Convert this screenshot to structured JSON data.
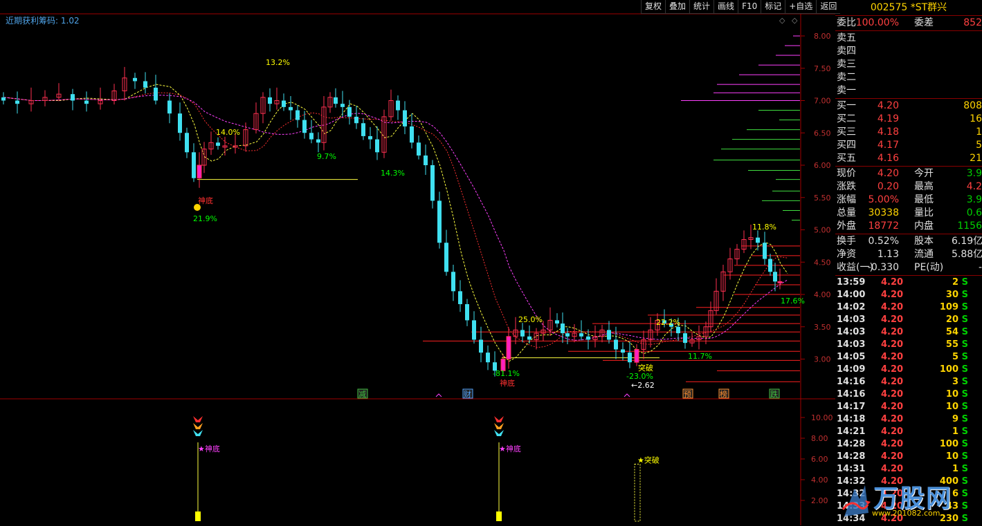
{
  "toolbar": {
    "items": [
      "复权",
      "叠加",
      "统计",
      "画线",
      "F10",
      "标记",
      "+自选",
      "返回"
    ]
  },
  "indicator": {
    "name": "近期获利筹码",
    "value": "1.02"
  },
  "stock": {
    "code": "002575",
    "name": "*ST群兴"
  },
  "quote": {
    "weibi_label": "委比",
    "weibi": "100.00%",
    "weicha_label": "委差",
    "weicha": "852",
    "sell": [
      {
        "label": "卖五",
        "price": "",
        "vol": ""
      },
      {
        "label": "卖四",
        "price": "",
        "vol": ""
      },
      {
        "label": "卖三",
        "price": "",
        "vol": ""
      },
      {
        "label": "卖二",
        "price": "",
        "vol": ""
      },
      {
        "label": "卖一",
        "price": "",
        "vol": ""
      }
    ],
    "buy": [
      {
        "label": "买一",
        "price": "4.20",
        "vol": "808"
      },
      {
        "label": "买二",
        "price": "4.19",
        "vol": "16"
      },
      {
        "label": "买三",
        "price": "4.18",
        "vol": "1"
      },
      {
        "label": "买四",
        "price": "4.17",
        "vol": "5"
      },
      {
        "label": "买五",
        "price": "4.16",
        "vol": "21"
      }
    ],
    "stats": [
      {
        "l": "现价",
        "v": "4.20",
        "vc": "red",
        "l2": "今开",
        "v2": "3.9",
        "v2c": "grn"
      },
      {
        "l": "涨跌",
        "v": "0.20",
        "vc": "red",
        "l2": "最高",
        "v2": "4.2",
        "v2c": "red"
      },
      {
        "l": "涨幅",
        "v": "5.00%",
        "vc": "red",
        "l2": "最低",
        "v2": "3.9",
        "v2c": "grn"
      },
      {
        "l": "总量",
        "v": "30338",
        "vc": "yel",
        "l2": "量比",
        "v2": "0.6",
        "v2c": "grn"
      },
      {
        "l": "外盘",
        "v": "18772",
        "vc": "red",
        "l2": "内盘",
        "v2": "1156",
        "v2c": "grn"
      }
    ],
    "fund": [
      {
        "l": "换手",
        "v": "0.52%",
        "l2": "股本",
        "v2": "6.19亿"
      },
      {
        "l": "净资",
        "v": "1.13",
        "l2": "流通",
        "v2": "5.88亿"
      },
      {
        "l": "收益(一)",
        "v": "-0.330",
        "l2": "PE(动)",
        "v2": "-"
      }
    ]
  },
  "ticks": [
    {
      "t": "13:59",
      "p": "4.20",
      "q": "2",
      "s": "S"
    },
    {
      "t": "14:00",
      "p": "4.20",
      "q": "30",
      "s": "S"
    },
    {
      "t": "14:02",
      "p": "4.20",
      "q": "109",
      "s": "S"
    },
    {
      "t": "14:03",
      "p": "4.20",
      "q": "20",
      "s": "S"
    },
    {
      "t": "14:03",
      "p": "4.20",
      "q": "54",
      "s": "S"
    },
    {
      "t": "14:03",
      "p": "4.20",
      "q": "55",
      "s": "S"
    },
    {
      "t": "14:05",
      "p": "4.20",
      "q": "5",
      "s": "S"
    },
    {
      "t": "14:09",
      "p": "4.20",
      "q": "100",
      "s": "S"
    },
    {
      "t": "14:16",
      "p": "4.20",
      "q": "3",
      "s": "S"
    },
    {
      "t": "14:16",
      "p": "4.20",
      "q": "10",
      "s": "S"
    },
    {
      "t": "14:17",
      "p": "4.20",
      "q": "10",
      "s": "S"
    },
    {
      "t": "14:18",
      "p": "4.20",
      "q": "9",
      "s": "S"
    },
    {
      "t": "14:21",
      "p": "4.20",
      "q": "1",
      "s": "S"
    },
    {
      "t": "14:28",
      "p": "4.20",
      "q": "100",
      "s": "S"
    },
    {
      "t": "14:28",
      "p": "4.20",
      "q": "10",
      "s": "S"
    },
    {
      "t": "14:31",
      "p": "4.20",
      "q": "1",
      "s": "S"
    },
    {
      "t": "14:32",
      "p": "4.20",
      "q": "400",
      "s": "S"
    },
    {
      "t": "14:32",
      "p": "4.20",
      "q": "6",
      "s": "S"
    },
    {
      "t": "14:33",
      "p": "4.20",
      "q": "43",
      "s": "S"
    },
    {
      "t": "14:34",
      "p": "4.20",
      "q": "230",
      "s": "S"
    }
  ],
  "watermark": {
    "brand": "万股网",
    "url": "www.201082.com"
  },
  "chart_data": [
    {
      "type": "candlestick",
      "price_axis": [
        "8.00",
        "7.50",
        "7.00",
        "6.50",
        "6.00",
        "5.50",
        "5.00",
        "4.50",
        "4.00",
        "3.50",
        "3.00"
      ],
      "ylim": [
        2.6,
        8.3
      ],
      "annotations": [
        {
          "text": "13.2%",
          "color": "#ffff00"
        },
        {
          "text": "14.0%",
          "color": "#ffff00"
        },
        {
          "text": "9.7%",
          "color": "#00ff00"
        },
        {
          "text": "14.3%",
          "color": "#00ff00"
        },
        {
          "text": "21.9%",
          "color": "#00ff00"
        },
        {
          "text": "神底",
          "color": "#ff3030"
        },
        {
          "text": "25.0%",
          "color": "#ffff00"
        },
        {
          "text": "-81.1%",
          "color": "#00ff00"
        },
        {
          "text": "神底",
          "color": "#ff3030"
        },
        {
          "text": "22.2%",
          "color": "#ffff00"
        },
        {
          "text": "突破",
          "color": "#ffff00"
        },
        {
          "text": "-23.0%",
          "color": "#00ff00"
        },
        {
          "text": "←2.62",
          "color": "#ffffff"
        },
        {
          "text": "11.7%",
          "color": "#00ff00"
        },
        {
          "text": "11.8%",
          "color": "#ffff00"
        },
        {
          "text": "17.6%",
          "color": "#00ff00"
        }
      ],
      "event_tags": [
        "减",
        "财",
        "预",
        "榜",
        "跌"
      ]
    },
    {
      "type": "bar",
      "title": "indicator",
      "yaxis": [
        "10.00",
        "8.00",
        "6.00",
        "4.00",
        "2.00"
      ],
      "ylim": [
        0,
        11
      ],
      "signals": [
        {
          "label": "★神底",
          "value": 10,
          "color": "#ff40ff"
        },
        {
          "label": "★神底",
          "value": 10,
          "color": "#ff40ff"
        },
        {
          "label": "★突破",
          "value": 5.5,
          "color": "#ffff00"
        }
      ]
    }
  ]
}
